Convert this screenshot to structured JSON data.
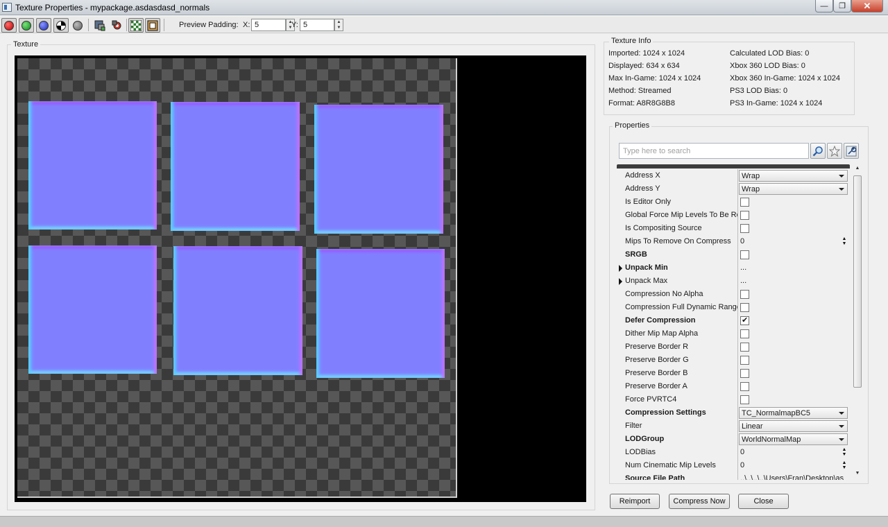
{
  "window": {
    "title": "Texture Properties - mypackage.asdasdasd_normals",
    "minimize": "—",
    "maximize": "❐",
    "close": "✕"
  },
  "toolbar": {
    "channel_buttons": [
      {
        "name": "red-channel-icon",
        "color": "#d81c1c"
      },
      {
        "name": "green-channel-icon",
        "color": "#1aa82a"
      },
      {
        "name": "blue-channel-icon",
        "color": "#2e3fd8"
      },
      {
        "name": "alpha-channel-icon",
        "color": "#000000"
      },
      {
        "name": "saturation-icon",
        "color": "#7a7a7a"
      }
    ],
    "preview_padding_label": "Preview Padding:",
    "x_label": "X:",
    "x_value": "5",
    "y_label": "Y:",
    "y_value": "5"
  },
  "texture_panel": {
    "title": "Texture"
  },
  "texture_info": {
    "title": "Texture Info",
    "left": [
      "Imported: 1024 x 1024",
      "Displayed: 634 x 634",
      "Max In-Game: 1024 x 1024",
      "Method: Streamed",
      "Format: A8R8G8B8"
    ],
    "right": [
      "Calculated LOD Bias: 0",
      "Xbox 360 LOD Bias: 0",
      "Xbox 360 In-Game: 1024 x 1024",
      "PS3 LOD Bias: 0",
      "PS3 In-Game: 1024 x 1024"
    ]
  },
  "properties": {
    "title": "Properties",
    "search_placeholder": "Type here to search",
    "rows": [
      {
        "name": "Address X",
        "type": "combo",
        "value": "Wrap"
      },
      {
        "name": "Address Y",
        "type": "combo",
        "value": "Wrap"
      },
      {
        "name": "Is Editor Only",
        "type": "check",
        "checked": false
      },
      {
        "name": "Global Force Mip Levels To Be Resident",
        "type": "check",
        "checked": false
      },
      {
        "name": "Is Compositing Source",
        "type": "check",
        "checked": false
      },
      {
        "name": "Mips To Remove On Compress",
        "type": "spin",
        "value": "0"
      },
      {
        "name": "SRGB",
        "type": "check",
        "checked": false,
        "bold": true
      },
      {
        "name": "Unpack Min",
        "type": "text",
        "value": "...",
        "bold": true,
        "expandable": true
      },
      {
        "name": "Unpack Max",
        "type": "text",
        "value": "...",
        "expandable": true
      },
      {
        "name": "Compression No Alpha",
        "type": "check",
        "checked": false
      },
      {
        "name": "Compression Full Dynamic Range",
        "type": "check",
        "checked": false
      },
      {
        "name": "Defer Compression",
        "type": "check",
        "checked": true,
        "bold": true
      },
      {
        "name": "Dither Mip Map Alpha",
        "type": "check",
        "checked": false
      },
      {
        "name": "Preserve Border R",
        "type": "check",
        "checked": false
      },
      {
        "name": "Preserve Border G",
        "type": "check",
        "checked": false
      },
      {
        "name": "Preserve Border B",
        "type": "check",
        "checked": false
      },
      {
        "name": "Preserve Border A",
        "type": "check",
        "checked": false
      },
      {
        "name": "Force PVRTC4",
        "type": "check",
        "checked": false
      },
      {
        "name": "Compression Settings",
        "type": "combo",
        "value": "TC_NormalmapBC5",
        "bold": true
      },
      {
        "name": "Filter",
        "type": "combo",
        "value": "Linear"
      },
      {
        "name": "LODGroup",
        "type": "combo",
        "value": "WorldNormalMap",
        "bold": true
      },
      {
        "name": "LODBias",
        "type": "spin",
        "value": "0"
      },
      {
        "name": "Num Cinematic Mip Levels",
        "type": "spin",
        "value": "0"
      },
      {
        "name": "Source File Path",
        "type": "text",
        "value": "..\\..\\..\\..\\Users\\Fran\\Desktop\\as",
        "bold": true
      }
    ]
  },
  "buttons": {
    "reimport": "Reimport",
    "compress_now": "Compress Now",
    "close": "Close"
  }
}
